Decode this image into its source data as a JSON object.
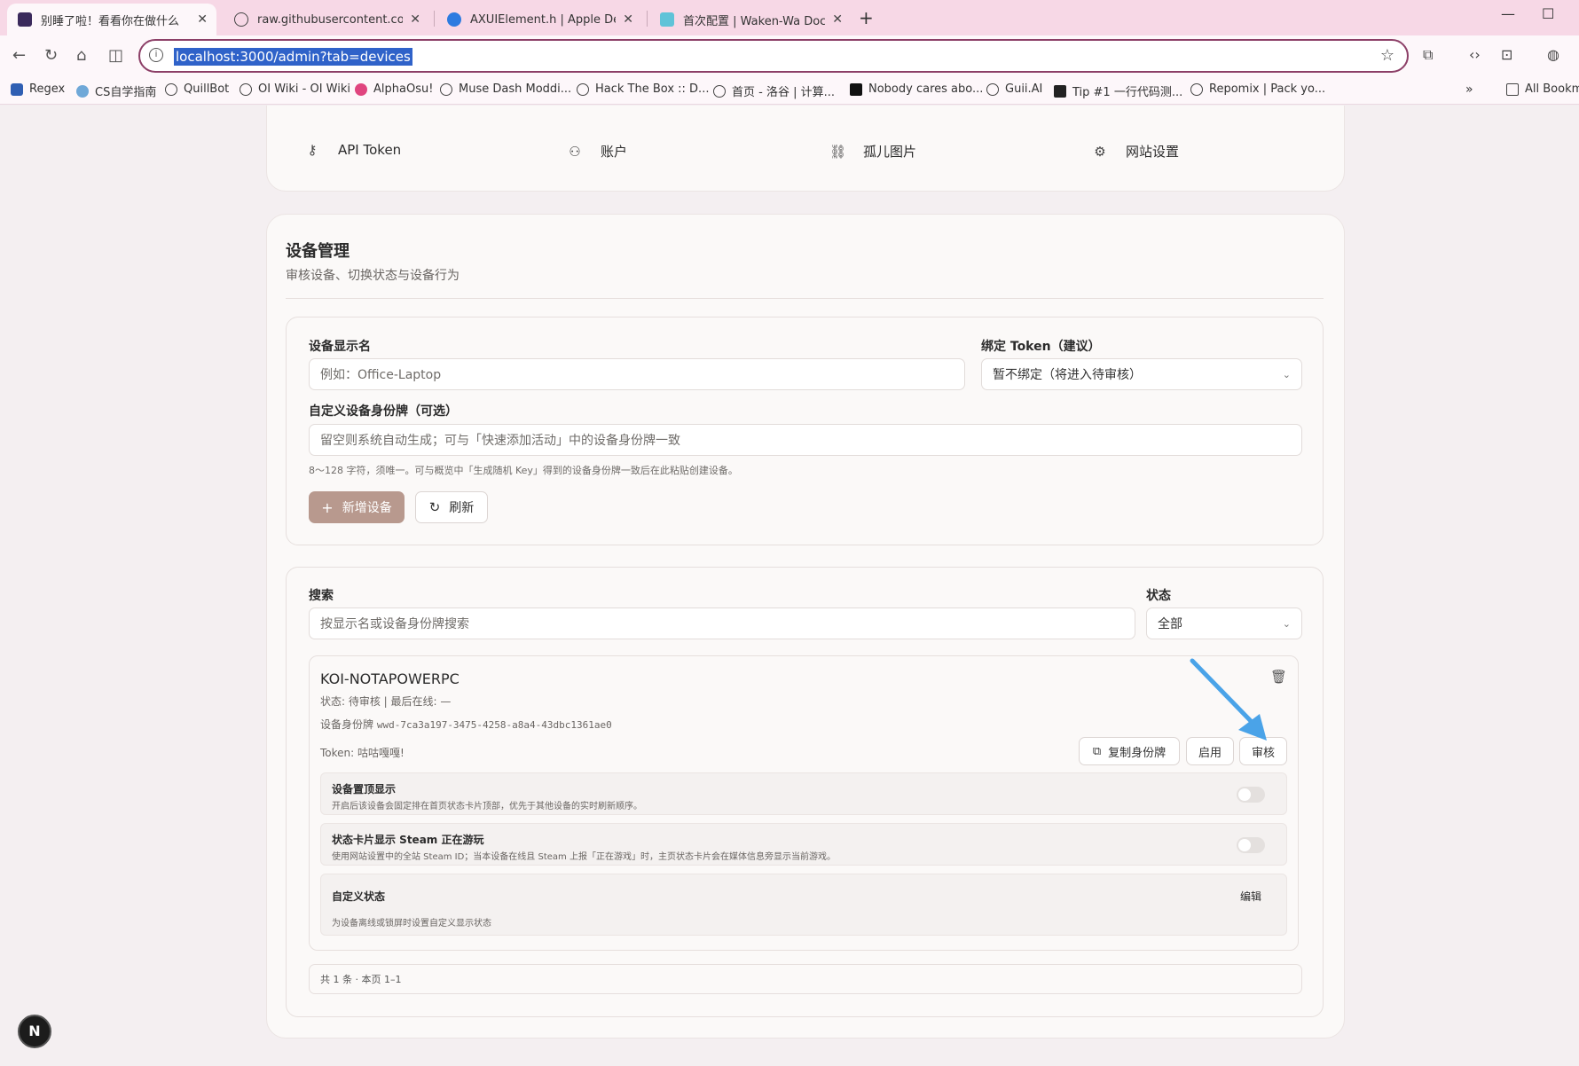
{
  "browser": {
    "tabs": [
      {
        "title": "别睡了啦！看看你在做什么",
        "active": true
      },
      {
        "title": "raw.githubusercontent.com/M",
        "active": false
      },
      {
        "title": "AXUIElement.h | Apple Develo",
        "active": false
      },
      {
        "title": "首次配置 | Waken-Wa Docume",
        "active": false
      }
    ],
    "url": "localhost:3000/admin?tab=devices",
    "bookmarks": [
      "Regex",
      "CS自学指南",
      "QuillBot",
      "OI Wiki - OI Wiki",
      "AlphaOsu!",
      "Muse Dash Moddi...",
      "Hack The Box :: D...",
      "首页 - 洛谷 | 计算...",
      "Nobody cares abo...",
      "Guii.AI",
      "Tip #1 一行代码测...",
      "Repomix | Pack yo..."
    ],
    "all_bookmarks": "All Bookmarks"
  },
  "top_nav": {
    "items": [
      {
        "label": "API Token",
        "icon": "key-icon"
      },
      {
        "label": "账户",
        "icon": "user-gear-icon"
      },
      {
        "label": "孤儿图片",
        "icon": "broken-link-icon"
      },
      {
        "label": "网站设置",
        "icon": "gear-icon"
      }
    ]
  },
  "device_management": {
    "title": "设备管理",
    "subtitle": "审核设备、切换状态与设备行为",
    "form": {
      "display_name_label": "设备显示名",
      "display_name_placeholder": "例如：Office-Laptop",
      "bind_token_label": "绑定 Token（建议）",
      "bind_token_value": "暂不绑定（将进入待审核）",
      "custom_id_label": "自定义设备身份牌（可选）",
      "custom_id_placeholder": "留空则系统自动生成；可与「快速添加活动」中的设备身份牌一致",
      "custom_id_hint": "8～128 字符，须唯一。可与概览中「生成随机 Key」得到的设备身份牌一致后在此粘贴创建设备。",
      "add_button": "新增设备",
      "refresh_button": "刷新"
    },
    "filter": {
      "search_label": "搜索",
      "search_placeholder": "按显示名或设备身份牌搜索",
      "status_label": "状态",
      "status_value": "全部"
    },
    "devices": [
      {
        "name": "KOI-NOTAPOWERPC",
        "status_line": "状态: 待审核 | 最后在线: —",
        "id_label": "设备身份牌",
        "id_value": "wwd-7ca3a197-3475-4258-a8a4-43dbc1361ae0",
        "token_line": "Token: 咕咕嘎嘎!",
        "copy_button": "复制身份牌",
        "enable_button": "启用",
        "review_button": "审核",
        "settings": [
          {
            "title": "设备置顶显示",
            "desc": "开启后该设备会固定排在首页状态卡片顶部，优先于其他设备的实时刷新顺序。",
            "enabled": false
          },
          {
            "title": "状态卡片显示 Steam 正在游玩",
            "desc": "使用网站设置中的全站 Steam ID；当本设备在线且 Steam 上报「正在游戏」时，主页状态卡片会在媒体信息旁显示当前游戏。",
            "enabled": false
          }
        ],
        "custom_status": {
          "title": "自定义状态",
          "desc": "为设备离线或锁屏时设置自定义显示状态",
          "edit": "编辑"
        }
      }
    ],
    "pagination": "共 1 条 · 本页 1–1"
  },
  "badge": "N",
  "colors": {
    "accent": "#b8998e",
    "arrow": "#4aa3e8",
    "omnibox_border": "#8c3f67"
  }
}
